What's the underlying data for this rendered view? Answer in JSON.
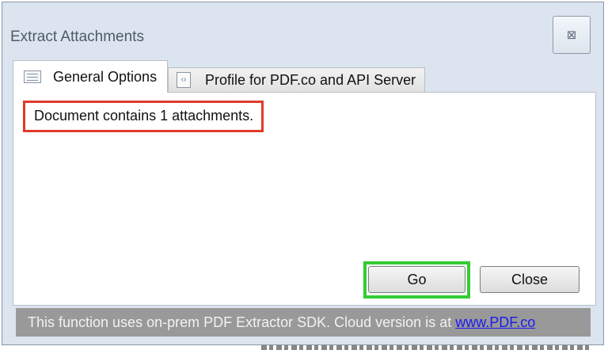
{
  "window": {
    "title": "Extract Attachments",
    "close_glyph": "⊠"
  },
  "tabs": [
    {
      "label": "General Options",
      "icon": "list-icon",
      "active": true
    },
    {
      "label": "Profile for PDF.co and API Server",
      "icon": "code-file-icon",
      "active": false
    }
  ],
  "panel": {
    "message": "Document contains 1 attachments."
  },
  "buttons": {
    "go_label": "Go",
    "close_label": "Close"
  },
  "status": {
    "text": "This function uses on-prem PDF Extractor SDK. Cloud version is at ",
    "link_text": "www.PDF.co"
  },
  "colors": {
    "message_highlight": "#e03a2a",
    "go_highlight": "#33cc33",
    "link": "#1a1aee",
    "statusbar_bg": "#999999"
  }
}
